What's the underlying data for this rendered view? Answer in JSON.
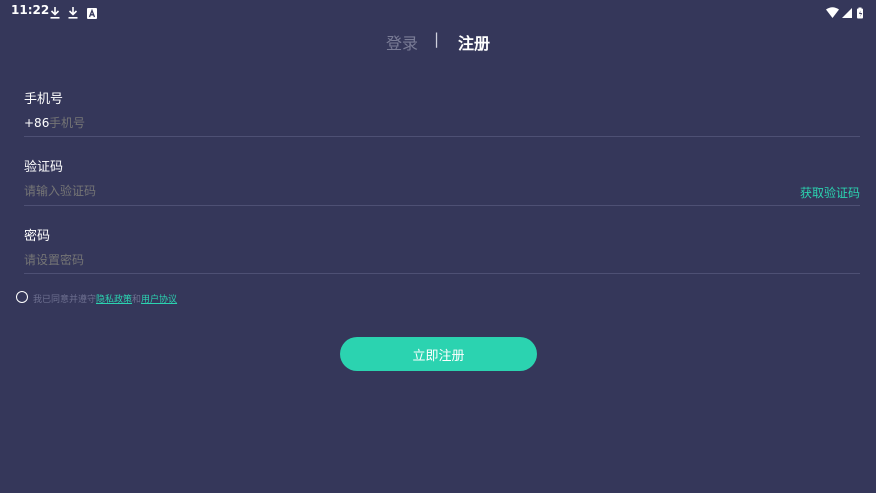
{
  "status_bar": {
    "time": "11:22",
    "icons": [
      "download-icon",
      "download-icon",
      "notification-a-icon"
    ],
    "right_icons": [
      "wifi-icon",
      "signal-icon",
      "battery-icon"
    ]
  },
  "tabs": {
    "login": "登录",
    "separator": "|",
    "register": "注册"
  },
  "form": {
    "phone": {
      "label": "手机号",
      "prefix": "+86",
      "placeholder": "手机号",
      "value": ""
    },
    "code": {
      "label": "验证码",
      "placeholder": "请输入验证码",
      "value": "",
      "get_code": "获取验证码"
    },
    "password": {
      "label": "密码",
      "placeholder": "请设置密码",
      "value": ""
    }
  },
  "agreement": {
    "prefix": "我已同意并遵守",
    "privacy": "隐私政策",
    "and": "和",
    "terms": "用户协议",
    "checked": false
  },
  "submit_label": "立即注册",
  "colors": {
    "background": "#35375a",
    "accent": "#2bd3b0",
    "divider": "#4e5074",
    "muted_text": "#6e7090"
  }
}
